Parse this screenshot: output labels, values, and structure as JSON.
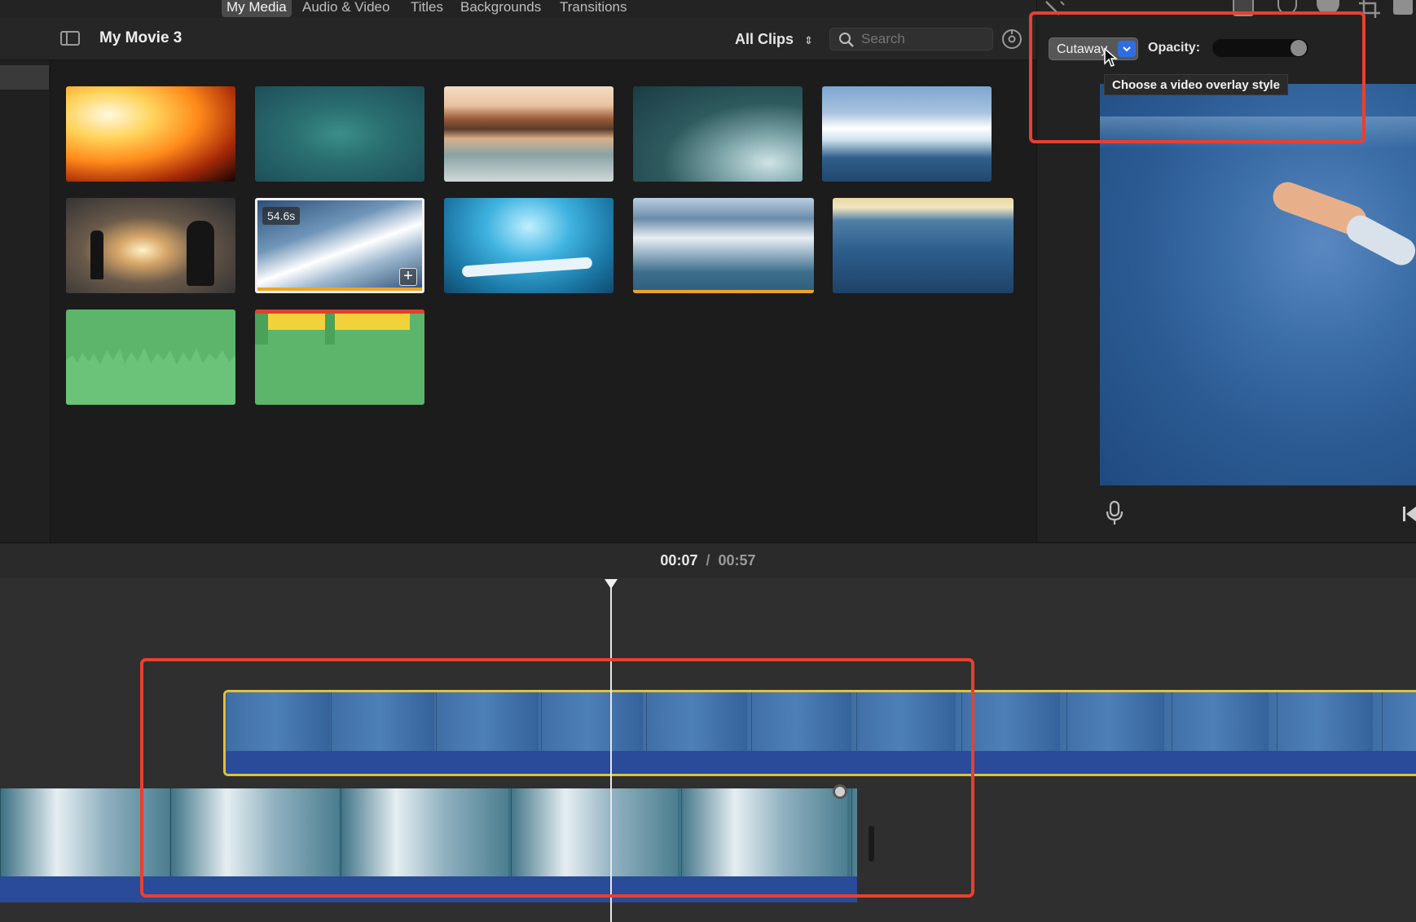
{
  "tabs": [
    {
      "label": "My Media",
      "active": true
    },
    {
      "label": "Audio & Video",
      "active": false
    },
    {
      "label": "Titles",
      "active": false
    },
    {
      "label": "Backgrounds",
      "active": false
    },
    {
      "label": "Transitions",
      "active": false
    }
  ],
  "browser": {
    "project_title": "My Movie 3",
    "filter_label": "All Clips",
    "search_placeholder": "Search"
  },
  "clips": {
    "selected_duration_badge": "54.6s"
  },
  "overlay_controls": {
    "style_value": "Cutaway",
    "opacity_label": "Opacity:",
    "opacity": 1.0,
    "tooltip": "Choose a video overlay style"
  },
  "timeline": {
    "current_time": "00:07",
    "separator": "/",
    "total_time": "00:57"
  },
  "colors": {
    "highlight": "#e8402f",
    "cutaway_border": "#e0c13a",
    "audio_band": "#2a4a9a",
    "audio_clip": "#5cb56a",
    "accent_blue": "#2f6ee0"
  },
  "icons": [
    "sidebar-toggle-icon",
    "search-icon",
    "settings-icon",
    "magic-wand-icon",
    "crop-icon",
    "color-icon",
    "microphone-icon",
    "skip-back-icon",
    "playhead-icon",
    "add-clip-icon"
  ]
}
